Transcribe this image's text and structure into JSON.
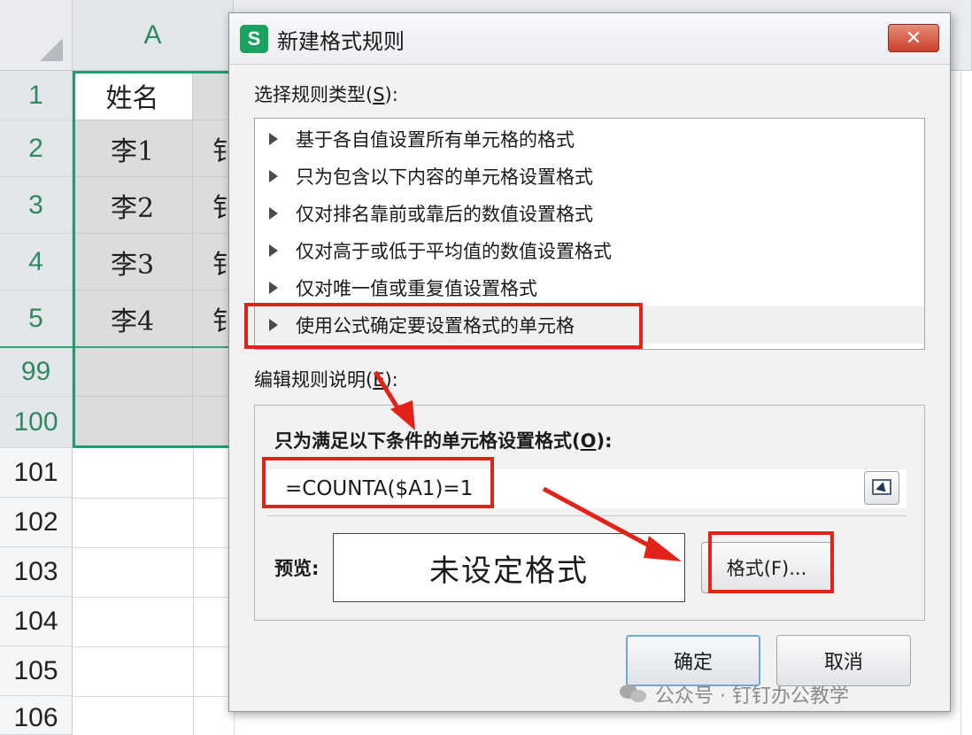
{
  "spreadsheet": {
    "column_header": "A",
    "rows": [
      {
        "row_number": "1",
        "name": "姓名",
        "clipped": ""
      },
      {
        "row_number": "2",
        "name": "李1",
        "clipped": "钅"
      },
      {
        "row_number": "3",
        "name": "李2",
        "clipped": "钅"
      },
      {
        "row_number": "4",
        "name": "李3",
        "clipped": "钅"
      },
      {
        "row_number": "5",
        "name": "李4",
        "clipped": "钅"
      },
      {
        "row_number": "99",
        "name": "",
        "clipped": ""
      },
      {
        "row_number": "100",
        "name": "",
        "clipped": ""
      }
    ],
    "empty_rows": [
      "101",
      "102",
      "103",
      "104",
      "105",
      "106"
    ],
    "selection_color": "#1e9e6a"
  },
  "dialog": {
    "app_icon_letter": "S",
    "title": "新建格式规则",
    "close_label": "✕",
    "rule_type_label": "选择规则类型(",
    "rule_type_key": "S",
    "rule_type_suffix": "):",
    "rule_types": [
      "基于各自值设置所有单元格的格式",
      "只为包含以下内容的单元格设置格式",
      "仅对排名靠前或靠后的数值设置格式",
      "仅对高于或低于平均值的数值设置格式",
      "仅对唯一值或重复值设置格式",
      "使用公式确定要设置格式的单元格"
    ],
    "selected_rule_index": 5,
    "edit_label": "编辑规则说明(",
    "edit_key": "E",
    "edit_suffix": "):",
    "condition_label": "只为满足以下条件的单元格设置格式(",
    "condition_key": "O",
    "condition_suffix": "):",
    "formula_value": "=COUNTA($A1)=1",
    "preview_label": "预览:",
    "preview_text": "未设定格式",
    "format_button": "格式(F)...",
    "ok_button": "确定",
    "cancel_button": "取消"
  },
  "watermark": {
    "text": "公众号 · 钉钉办公教学"
  },
  "annotation_color": "#e2231a"
}
